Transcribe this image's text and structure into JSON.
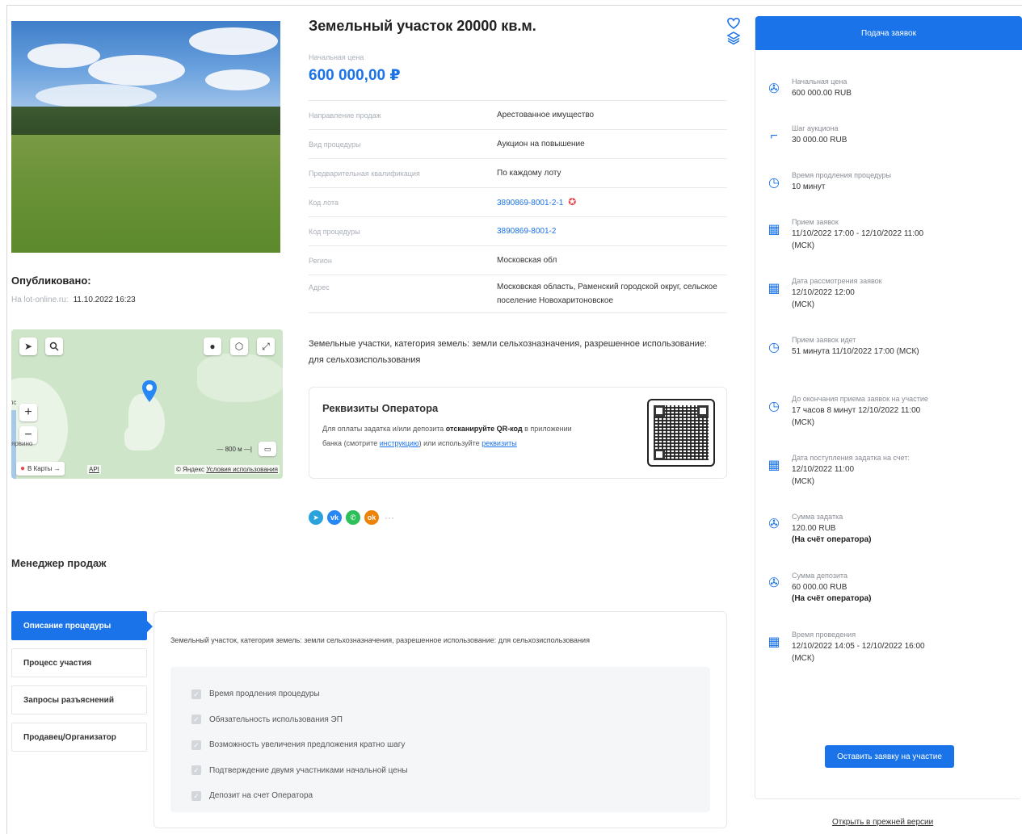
{
  "lot": {
    "title": "Земельный участок 20000 кв.м.",
    "price_label": "Начальная цена",
    "price_value": "600 000,00 ₽"
  },
  "published": {
    "title": "Опубликовано:",
    "site": "На lot-online.ru:",
    "date": "11.10.2022 16:23"
  },
  "map": {
    "karty_label": "В Карты →",
    "api_label": "API",
    "copyright": "© Яндекс",
    "terms_link": "Условия использования",
    "scale_label": "800 м",
    "place_label": "ярвино",
    "place_label_2": "пс"
  },
  "manager": {
    "title": "Менеджер продаж"
  },
  "properties": [
    {
      "key": "Направление продаж",
      "value": "Арестованное имущество"
    },
    {
      "key": "Вид процедуры",
      "value": "Аукцион на повышение"
    },
    {
      "key": "Предварительная квалификация",
      "value": "По каждому лоту"
    },
    {
      "key": "Код лота",
      "value": "3890869-8001-2-1"
    },
    {
      "key": "Код процедуры",
      "value": "3890869-8001-2"
    },
    {
      "key": "Регион",
      "value": "Московская обл"
    },
    {
      "key": "Адрес",
      "value": "Московская область, Раменский городской округ, сельское поселение Новохаритоновское"
    }
  ],
  "description": "Земельные участки, категория земель: земли сельхозназначения, разрешенное использование: для сельхозиспользования",
  "operator": {
    "title": "Реквизиты Оператора",
    "text_before": "Для оплаты задатка и/или депозита ",
    "text_bold": "отсканируйте QR-код",
    "text_middle": " в приложении банка (смотрите ",
    "link_instruction": "инструкцию",
    "text_after": ") или используйте ",
    "link_requisites": "реквизиты"
  },
  "share": {
    "telegram": "➤",
    "vk": "vk",
    "whatsapp": "✆",
    "ok": "ok",
    "more": "···"
  },
  "tabs": [
    {
      "label": "Описание процедуры",
      "active": true
    },
    {
      "label": "Процесс участия",
      "active": false
    },
    {
      "label": "Запросы разъяснений",
      "active": false
    },
    {
      "label": "Продавец/Организатор",
      "active": false
    }
  ],
  "tab_content": {
    "text": "Земельный участок, категория земель: земли сельхозназначения, разрешенное использование: для сельхозиспользования",
    "checks": [
      "Время продления процедуры",
      "Обязательность использования ЭП",
      "Возможность увеличения предложения кратно шагу",
      "Подтверждение двумя участниками начальной цены",
      "Депозит на счет Оператора"
    ]
  },
  "right": {
    "header": "Подача заявок",
    "items": [
      {
        "icon": "price-icon",
        "label": "Начальная цена",
        "value": "600 000.00 RUB",
        "note": ""
      },
      {
        "icon": "step-icon",
        "label": "Шаг аукциона",
        "value": "30 000.00 RUB",
        "note": ""
      },
      {
        "icon": "clock-icon",
        "label": "Время продления процедуры",
        "value": "10 минут",
        "note": ""
      },
      {
        "icon": "calendar-icon",
        "label": "Прием заявок",
        "value": "11/10/2022 17:00 - 12/10/2022 11:00 (МСК)",
        "note": ""
      },
      {
        "icon": "calendar-icon",
        "label": "Дата рассмотрения заявок",
        "value": "12/10/2022 12:00 (МСК)",
        "note": ""
      },
      {
        "icon": "clock-icon",
        "label": "Прием заявок идет",
        "value": "51 минута 11/10/2022 17:00 (МСК)",
        "note": ""
      },
      {
        "icon": "clock-icon",
        "label": "До окончания приема заявок на участие",
        "value": "17 часов 8 минут 12/10/2022 11:00 (МСК)",
        "note": ""
      },
      {
        "icon": "calendar-icon",
        "label": "Дата поступления задатка на счет:",
        "value": "12/10/2022 11:00 (МСК)",
        "note": ""
      },
      {
        "icon": "price-icon",
        "label": "Сумма задатка",
        "value": "120.00 RUB",
        "note": "(На счёт оператора)"
      },
      {
        "icon": "price-icon",
        "label": "Сумма депозита",
        "value": "60 000.00 RUB",
        "note": "(На счёт оператора)"
      },
      {
        "icon": "calendar-icon",
        "label": "Время проведения",
        "value": "12/10/2022 14:05 - 12/10/2022 16:00 (МСК)",
        "note": ""
      }
    ],
    "apply_button": "Оставить заявку на участие",
    "old_version_link": "Открыть в прежней версии"
  },
  "colors": {
    "accent": "#1a73e8",
    "telegram": "#2aa3dd",
    "vk": "#2787f5",
    "whatsapp": "#2dbf5a",
    "ok": "#ee8208",
    "medal": "#e5484d"
  }
}
